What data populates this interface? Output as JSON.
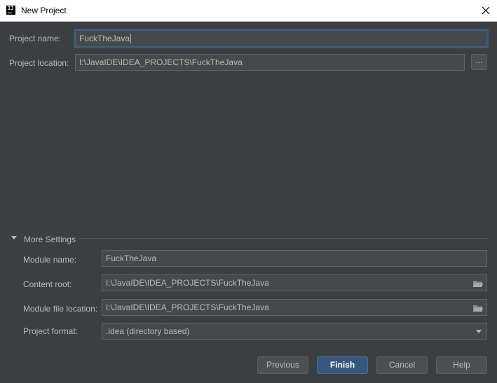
{
  "window": {
    "title": "New Project",
    "app_icon_text": "IJ"
  },
  "project": {
    "name_label": "Project name:",
    "name_value": "FuckTheJava",
    "location_label": "Project location:",
    "location_value": "I:\\JavaIDE\\IDEA_PROJECTS\\FuckTheJava",
    "browse_label": "..."
  },
  "more_settings": {
    "title": "More Settings",
    "expanded": true,
    "module_name_label": "Module name:",
    "module_name_value": "FuckTheJava",
    "content_root_label": "Content root:",
    "content_root_value": "I:\\JavaIDE\\IDEA_PROJECTS\\FuckTheJava",
    "module_file_label": "Module file location:",
    "module_file_value": "I:\\JavaIDE\\IDEA_PROJECTS\\FuckTheJava",
    "format_label": "Project format:",
    "format_value": ".idea (directory based)"
  },
  "buttons": {
    "previous": "Previous",
    "finish": "Finish",
    "cancel": "Cancel",
    "help": "Help"
  },
  "colors": {
    "background": "#3c3f41",
    "field_bg": "#45494a",
    "primary_button": "#365880",
    "focus_border": "#3d6185",
    "text": "#bbbbbb"
  },
  "icons": {
    "close": "close-icon",
    "folder": "folder-icon",
    "collapse": "triangle-down-icon",
    "dropdown": "chevron-down-icon"
  }
}
